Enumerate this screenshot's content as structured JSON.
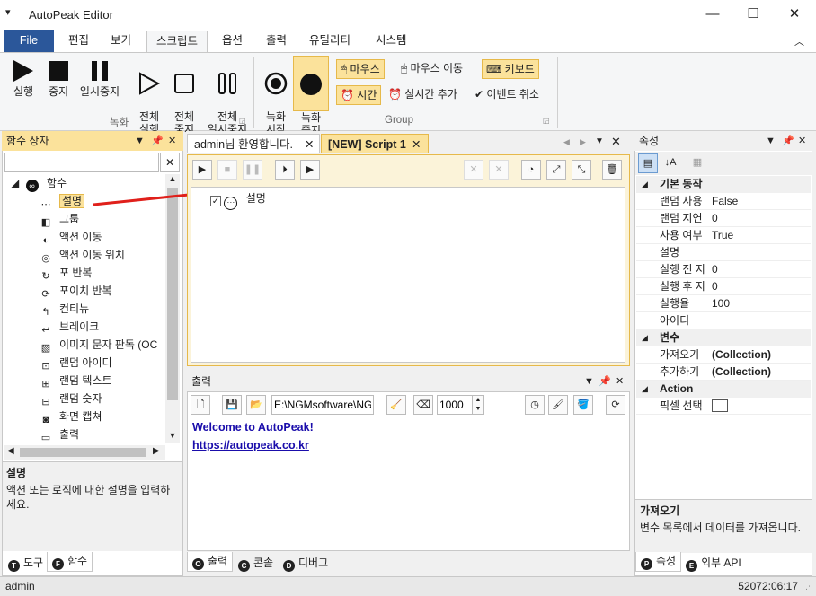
{
  "window": {
    "title": "AutoPeak Editor",
    "minimize": "—",
    "maximize": "☐",
    "close": "✕",
    "quick_access": "▾"
  },
  "ribbon_tabs": [
    "File",
    "편집",
    "보기",
    "스크립트",
    "옵션",
    "출력",
    "유틸리티",
    "시스템"
  ],
  "ribbon_collapse": "︿",
  "ribbon": {
    "record_group": {
      "label": "녹화",
      "buttons": [
        {
          "label": "실행",
          "icon": "play-icon"
        },
        {
          "label": "중지",
          "icon": "stop-icon"
        },
        {
          "label": "일시중지",
          "icon": "pause-icon"
        },
        {
          "label": "전체\n실행",
          "icon": "play-outline-icon"
        },
        {
          "label": "전체\n중지",
          "icon": "stop-outline-icon"
        },
        {
          "label": "전체\n일시중지",
          "icon": "pause-outline-icon"
        }
      ]
    },
    "group_group": {
      "label": "Group",
      "buttons": [
        {
          "label": "녹화\n시작",
          "icon": "record-start-icon"
        },
        {
          "label": "녹화\n중지",
          "icon": "record-stop-icon"
        }
      ],
      "toggles": {
        "mouse": "마우스",
        "mouse_move": "마우스 이동",
        "keyboard": "키보드",
        "time": "시간",
        "realtime_add": "실시간 추가",
        "event_cancel": "이벤트 취소"
      }
    }
  },
  "left_panel": {
    "title": "함수 상자",
    "search_value": "",
    "clear_label": "✕",
    "root": "함수",
    "items": [
      {
        "label": "설명",
        "icon": "ellipsis-circle-icon"
      },
      {
        "label": "그룹",
        "icon": "group-icon"
      },
      {
        "label": "액션 이동",
        "icon": "action-move-icon"
      },
      {
        "label": "액션 이동 위치",
        "icon": "target-icon"
      },
      {
        "label": "포 반복",
        "icon": "loop-icon"
      },
      {
        "label": "포이치 반복",
        "icon": "foreach-icon"
      },
      {
        "label": "컨티뉴",
        "icon": "continue-icon"
      },
      {
        "label": "브레이크",
        "icon": "break-icon"
      },
      {
        "label": "이미지 문자 판독 (OC",
        "icon": "ocr-icon"
      },
      {
        "label": "랜덤 아이디",
        "icon": "random-id-icon"
      },
      {
        "label": "랜덤 텍스트",
        "icon": "random-text-icon"
      },
      {
        "label": "랜덤 숫자",
        "icon": "random-number-icon"
      },
      {
        "label": "화면 캡쳐",
        "icon": "camera-icon"
      },
      {
        "label": "출력",
        "icon": "console-icon"
      }
    ],
    "desc_title": "설명",
    "desc_text": "액션 또는 로직에 대한 설명을 입력하세요.",
    "bottom_tabs": [
      {
        "badge": "T",
        "label": "도구"
      },
      {
        "badge": "F",
        "label": "함수"
      }
    ]
  },
  "doc_tabs": [
    {
      "label": "admin님 환영합니다.",
      "close": "✕"
    },
    {
      "label": "[NEW] Script 1",
      "close": "✕"
    }
  ],
  "script": {
    "line_label": "설명",
    "checked": true
  },
  "output_panel": {
    "title": "출력",
    "path": "E:\\NGMsoftware\\NG",
    "number": "1000",
    "lines": [
      "Welcome to AutoPeak!",
      "https://autopeak.co.kr"
    ],
    "bottom_tabs": [
      {
        "badge": "O",
        "label": "출력"
      },
      {
        "badge": "C",
        "label": "콘솔"
      },
      {
        "badge": "D",
        "label": "디버그"
      }
    ]
  },
  "properties": {
    "title": "속성",
    "categories": [
      {
        "name": "기본 동작",
        "rows": [
          {
            "name": "랜덤 사용",
            "value": "False"
          },
          {
            "name": "랜덤 지연",
            "value": "0"
          },
          {
            "name": "사용 여부",
            "value": "True"
          },
          {
            "name": "설명",
            "value": ""
          },
          {
            "name": "실행 전 지",
            "value": "0"
          },
          {
            "name": "실행 후 지",
            "value": "0"
          },
          {
            "name": "실행율",
            "value": "100"
          },
          {
            "name": "아이디",
            "value": ""
          }
        ]
      },
      {
        "name": "변수",
        "rows": [
          {
            "name": "가져오기",
            "value": "(Collection)"
          },
          {
            "name": "추가하기",
            "value": "(Collection)"
          }
        ]
      },
      {
        "name": "Action",
        "rows": [
          {
            "name": "픽셀 선택",
            "value": ""
          }
        ]
      }
    ],
    "desc_title": "가져오기",
    "desc_text": "변수 목록에서 데이터를 가져옵니다.",
    "bottom_tabs": [
      {
        "badge": "P",
        "label": "속성"
      },
      {
        "badge": "E",
        "label": "외부 API"
      }
    ]
  },
  "status": {
    "user": "admin",
    "clock": "52072:06:17"
  },
  "colors": {
    "accent": "#2b579a",
    "panel_header": "#fbe29b",
    "link": "#1a0dab",
    "arrow": "#e0201b"
  }
}
